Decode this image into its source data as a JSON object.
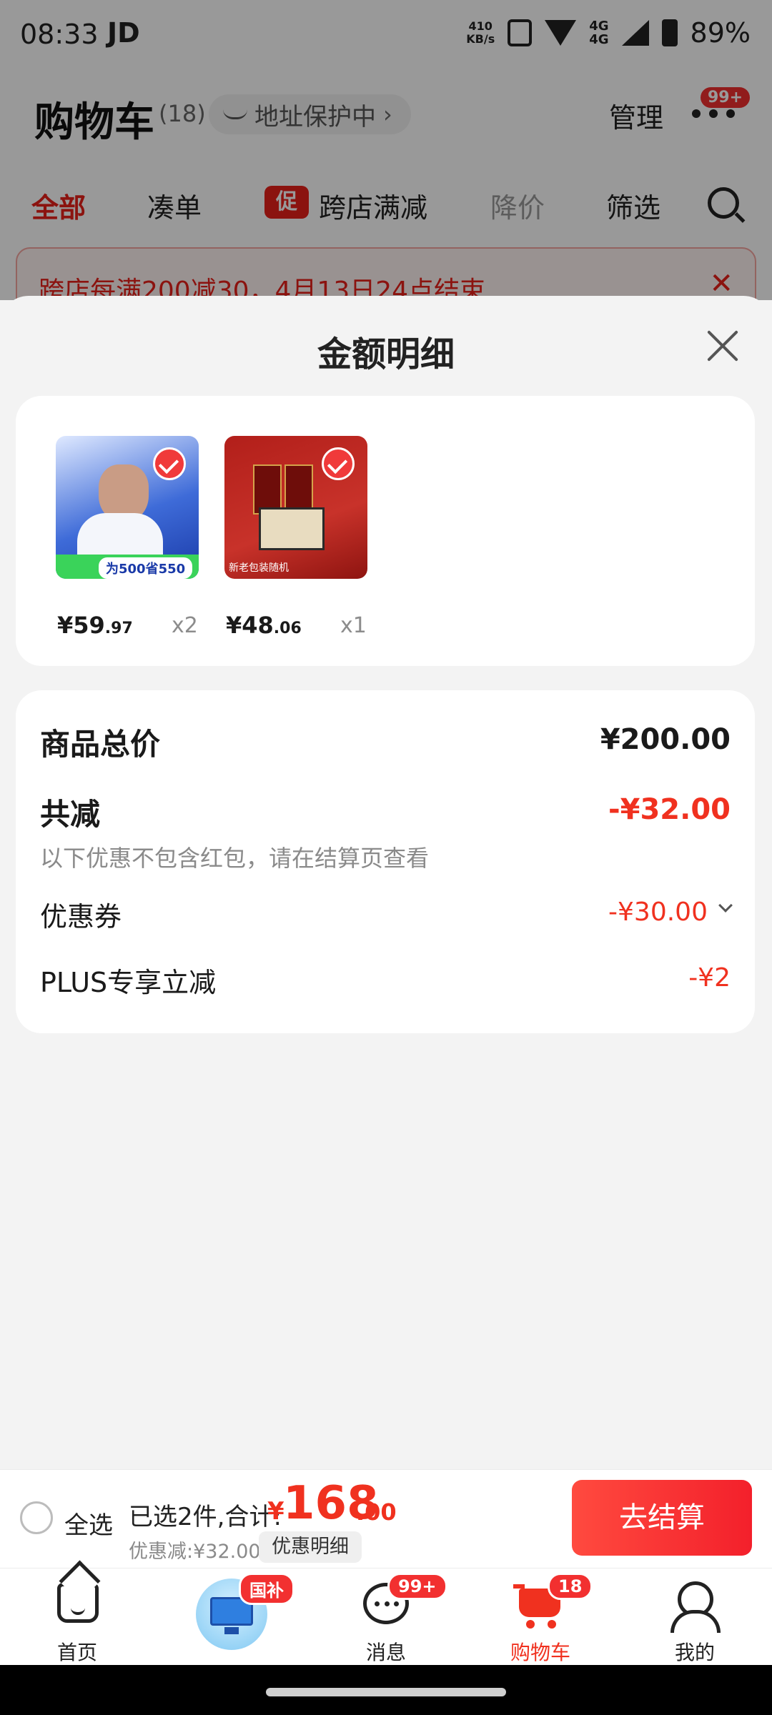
{
  "status_bar": {
    "time": "08:33",
    "carrier": "JD",
    "net_speed": "410",
    "net_speed_unit": "KB/s",
    "network": "4G",
    "battery": "89%"
  },
  "cart_header": {
    "title": "购物车",
    "count": "(18)",
    "address_label": "地址保护中",
    "manage_label": "管理",
    "more_badge": "99+"
  },
  "filter_tabs": {
    "all": "全部",
    "bundle": "凑单",
    "promo_tag": "促",
    "cross_store": "跨店满减",
    "price_drop": "降价",
    "filter": "筛选"
  },
  "promo_banner": {
    "text": "跨店每满200减30，4月13日24点结束"
  },
  "sheet": {
    "title": "金额明细",
    "products": [
      {
        "price_int": "¥59",
        "price_dec": ".97",
        "qty": "x2",
        "thumb_strip": "为500省550"
      },
      {
        "price_int": "¥48",
        "price_dec": ".06",
        "qty": "x1",
        "thumb_caption": "新老包装随机"
      }
    ],
    "summary": {
      "total_label": "商品总价",
      "total_value": "¥200.00",
      "discount_label": "共减",
      "discount_value": "-¥32.00",
      "discount_note": "以下优惠不包含红包，请在结算页查看",
      "coupon_label": "优惠券",
      "coupon_value": "-¥30.00",
      "plus_label": "PLUS专享立减",
      "plus_value": "-¥2"
    }
  },
  "checkout": {
    "select_all": "全选",
    "selected_summary": "已选2件,合计:",
    "currency": "¥",
    "total_int": "168",
    "total_dec": ".00",
    "discount_text": "优惠减:¥32.00",
    "detail_chip": "优惠明细",
    "checkout_button": "去结算"
  },
  "bottom_nav": {
    "home": "首页",
    "gov_badge": "国补",
    "messages": "消息",
    "messages_badge": "99+",
    "cart": "购物车",
    "cart_badge": "18",
    "me": "我的"
  },
  "colors": {
    "accent_red": "#f0311f",
    "sheet_bg": "#f3f3f3"
  }
}
